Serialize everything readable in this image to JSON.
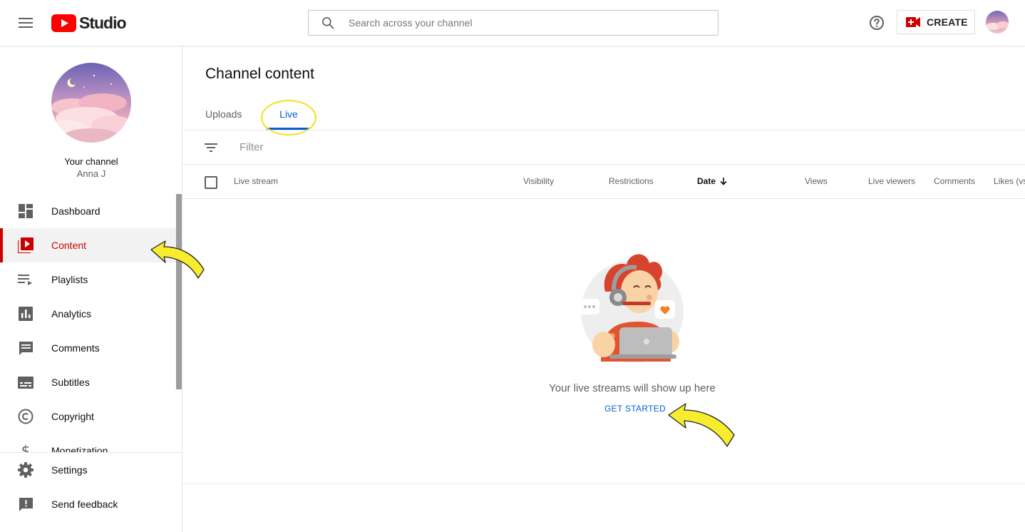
{
  "topbar": {
    "logo_text": "Studio",
    "search_placeholder": "Search across your channel",
    "create_label": "CREATE"
  },
  "sidebar": {
    "channel_title": "Your channel",
    "channel_name": "Anna J",
    "items": [
      {
        "label": "Dashboard",
        "icon": "dashboard-icon"
      },
      {
        "label": "Content",
        "icon": "content-icon",
        "active": true
      },
      {
        "label": "Playlists",
        "icon": "playlists-icon"
      },
      {
        "label": "Analytics",
        "icon": "analytics-icon"
      },
      {
        "label": "Comments",
        "icon": "comments-icon"
      },
      {
        "label": "Subtitles",
        "icon": "subtitles-icon"
      },
      {
        "label": "Copyright",
        "icon": "copyright-icon"
      },
      {
        "label": "Monetization",
        "icon": "monetization-icon"
      }
    ],
    "bottom_items": [
      {
        "label": "Settings",
        "icon": "settings-icon"
      },
      {
        "label": "Send feedback",
        "icon": "feedback-icon"
      }
    ]
  },
  "main": {
    "title": "Channel content",
    "tabs": [
      {
        "label": "Uploads"
      },
      {
        "label": "Live",
        "active": true
      }
    ],
    "filter_placeholder": "Filter",
    "columns": [
      "Live stream",
      "Visibility",
      "Restrictions",
      "Date",
      "Views",
      "Live viewers",
      "Comments",
      "Likes (vs. dislikes)"
    ],
    "sorted_column": "Date",
    "empty_message": "Your live streams will show up here",
    "empty_action": "GET STARTED"
  },
  "colors": {
    "accent": "#065fd4",
    "brand_red": "#cc0000",
    "annotation_yellow": "#f2e21a"
  }
}
